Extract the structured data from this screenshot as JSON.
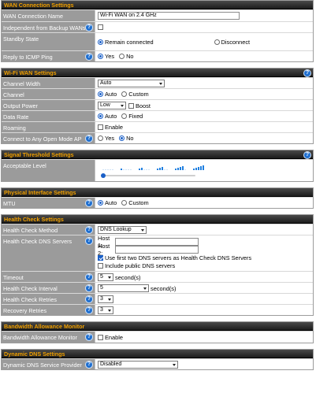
{
  "wan_connection": {
    "title": "WAN Connection Settings",
    "name_label": "WAN Connection Name",
    "name_value": "Wi-Fi WAN on 2.4 GHz",
    "independent_label": "Independent from Backup WANs",
    "standby_label": "Standby State",
    "standby_opt1": "Remain connected",
    "standby_opt2": "Disconnect",
    "icmp_label": "Reply to ICMP Ping",
    "icmp_yes": "Yes",
    "icmp_no": "No"
  },
  "wifi_wan": {
    "title": "Wi-Fi WAN Settings",
    "channel_width_label": "Channel Width",
    "channel_width_value": "Auto",
    "channel_label": "Channel",
    "channel_auto": "Auto",
    "channel_custom": "Custom",
    "output_power_label": "Output Power",
    "output_power_value": "Low",
    "boost_label": "Boost",
    "data_rate_label": "Data Rate",
    "data_rate_auto": "Auto",
    "data_rate_fixed": "Fixed",
    "roaming_label": "Roaming",
    "roaming_enable": "Enable",
    "open_ap_label": "Connect to Any Open Mode AP",
    "open_ap_yes": "Yes",
    "open_ap_no": "No"
  },
  "signal_threshold": {
    "title": "Signal Threshold Settings",
    "acceptable_label": "Acceptable Level",
    "level": 0
  },
  "physical_interface": {
    "title": "Physical Interface Settings",
    "mtu_label": "MTU",
    "mtu_auto": "Auto",
    "mtu_custom": "Custom"
  },
  "health_check": {
    "title": "Health Check Settings",
    "method_label": "Health Check Method",
    "method_value": "DNS Lookup",
    "dns_servers_label": "Health Check DNS Servers",
    "host1_label": "Host 1:",
    "host2_label": "Host 2:",
    "use_first_two": "Use first two DNS servers as Health Check DNS Servers",
    "include_public": "Include public DNS servers",
    "timeout_label": "Timeout",
    "timeout_value": "5",
    "timeout_unit": "second(s)",
    "interval_label": "Health Check Interval",
    "interval_value": "5",
    "interval_unit": "second(s)",
    "retries_label": "Health Check Retries",
    "retries_value": "3",
    "recovery_label": "Recovery Retries",
    "recovery_value": "3"
  },
  "bandwidth": {
    "title": "Bandwidth Allowance Monitor",
    "monitor_label": "Bandwidth Allowance Monitor",
    "enable": "Enable"
  },
  "dynamic_dns": {
    "title": "Dynamic DNS Settings",
    "provider_label": "Dynamic DNS Service Provider",
    "provider_value": "Disabled"
  },
  "help_glyph": "?",
  "colors": {
    "header_text": "#f2a100",
    "label_bg": "#9b9b9b",
    "help_icon": "#1f6fd0",
    "accent": "#1a5fc7"
  }
}
